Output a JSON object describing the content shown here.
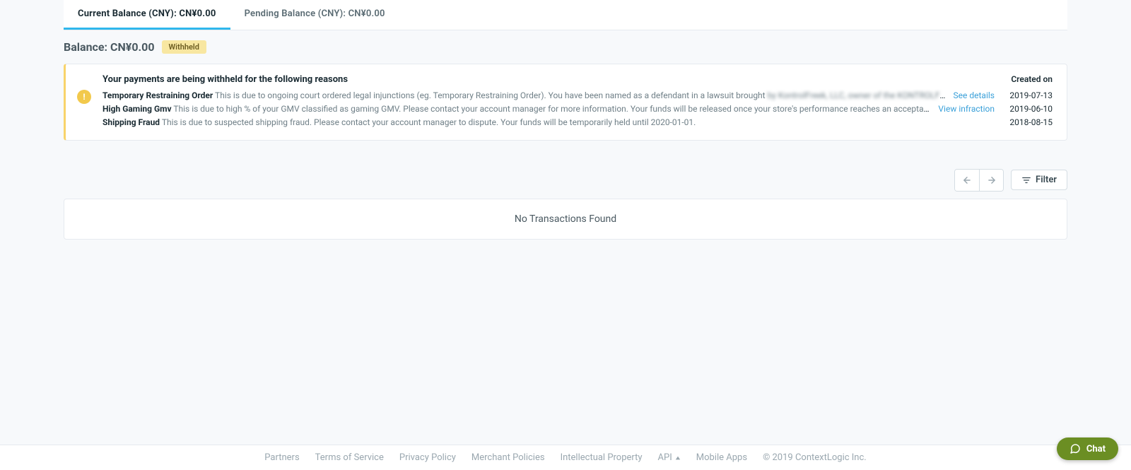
{
  "tabs": {
    "current": "Current Balance (CNY): CN¥0.00",
    "pending": "Pending Balance (CNY): CN¥0.00"
  },
  "balance": {
    "label": "Balance: CN¥0.00",
    "badge": "Withheld"
  },
  "alert": {
    "title": "Your payments are being withheld for the following reasons",
    "created_header": "Created on",
    "reasons": [
      {
        "name": "Temporary Restraining Order",
        "desc": "This is due to ongoing court ordered legal injunctions (eg. Temporary Restraining Order). You have been named as a defendant in a lawsuit brought",
        "blur": "by KontrolFreek, LLC, owner of the KONTROLFRE…",
        "link": "See details",
        "date": "2019-07-13"
      },
      {
        "name": "High Gaming Gmv",
        "desc": "This is due to high % of your GMV classified as gaming GMV. Please contact your account manager for more information. Your funds will be released once your store's performance reaches an acceptable le…",
        "blur": "",
        "link": "View infraction",
        "date": "2019-06-10"
      },
      {
        "name": "Shipping Fraud",
        "desc": "This is due to suspected shipping fraud. Please contact your account manager to dispute. Your funds will be temporarily held until 2020-01-01.",
        "blur": "",
        "link": "",
        "date": "2018-08-15"
      }
    ]
  },
  "controls": {
    "filter": "Filter"
  },
  "table": {
    "empty": "No Transactions Found"
  },
  "footer": {
    "links": [
      "Partners",
      "Terms of Service",
      "Privacy Policy",
      "Merchant Policies",
      "Intellectual Property",
      "API",
      "Mobile Apps"
    ],
    "copyright": "© 2019 ContextLogic Inc."
  },
  "chat": {
    "label": "Chat"
  }
}
